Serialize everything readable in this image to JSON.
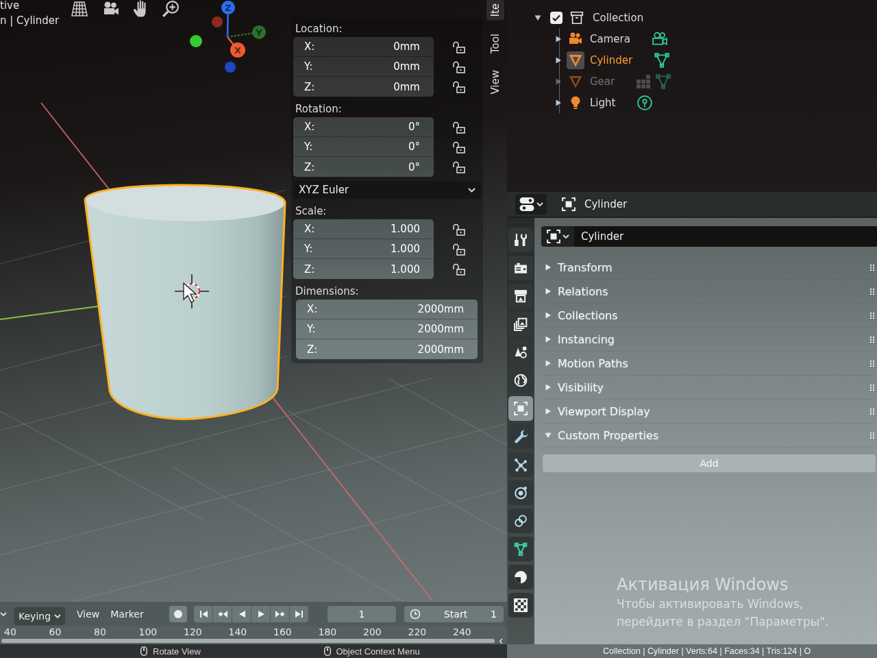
{
  "viewport": {
    "header": {
      "view_name": "tive",
      "object_info": "n | Cylinder"
    },
    "gizmo": [
      {
        "label": "Z",
        "color": "#2a6ff0"
      },
      {
        "label": "X",
        "color": "#ef5a32"
      },
      {
        "label": "Y",
        "color": "#2f6e2c"
      }
    ],
    "sidebar": {
      "tabs": [
        {
          "label": "Ite",
          "selected": true
        },
        {
          "label": "Tool",
          "selected": false
        },
        {
          "label": "View",
          "selected": false
        }
      ],
      "sections": [
        {
          "kind": "vector",
          "label": "Location:",
          "fields": [
            {
              "axis": "X:",
              "value": "0mm",
              "locked": false
            },
            {
              "axis": "Y:",
              "value": "0mm",
              "locked": false
            },
            {
              "axis": "Z:",
              "value": "0mm",
              "locked": false
            }
          ]
        },
        {
          "kind": "vector",
          "label": "Rotation:",
          "fields": [
            {
              "axis": "X:",
              "value": "0°",
              "locked": false
            },
            {
              "axis": "Y:",
              "value": "0°",
              "locked": false
            },
            {
              "axis": "Z:",
              "value": "0°",
              "locked": false
            }
          ]
        },
        {
          "kind": "dropdown",
          "value": "XYZ Euler"
        },
        {
          "kind": "vector",
          "label": "Scale:",
          "fields": [
            {
              "axis": "X:",
              "value": "1.000",
              "locked": false
            },
            {
              "axis": "Y:",
              "value": "1.000",
              "locked": false
            },
            {
              "axis": "Z:",
              "value": "1.000",
              "locked": false
            }
          ]
        },
        {
          "kind": "vector",
          "label": "Dimensions:",
          "fields": [
            {
              "axis": "X:",
              "value": "2000mm"
            },
            {
              "axis": "Y:",
              "value": "2000mm"
            },
            {
              "axis": "Z:",
              "value": "2000mm"
            }
          ]
        }
      ]
    }
  },
  "timeline": {
    "menus": [
      {
        "label": "Keying",
        "kind": "dropdown"
      },
      {
        "label": "View",
        "kind": "menu"
      },
      {
        "label": "Marker",
        "kind": "menu"
      }
    ],
    "current_frame": "1",
    "start": {
      "label": "Start",
      "value": "1"
    },
    "ruler": [
      "40",
      "60",
      "80",
      "100",
      "120",
      "140",
      "160",
      "180",
      "200",
      "220",
      "240"
    ]
  },
  "outliner": {
    "items": [
      {
        "label": "Collection",
        "kind": "collection",
        "expanded": true,
        "checked": true,
        "selected": false,
        "hidden": false,
        "children": [
          {
            "label": "Camera",
            "kind": "camera",
            "expanded": false,
            "selected": false,
            "hidden": false,
            "modifiers": false
          },
          {
            "label": "Cylinder",
            "kind": "mesh",
            "expanded": false,
            "selected": true,
            "hidden": false,
            "modifiers": false
          },
          {
            "label": "Gear",
            "kind": "mesh",
            "expanded": false,
            "selected": false,
            "hidden": true,
            "modifiers": true
          },
          {
            "label": "Light",
            "kind": "light",
            "expanded": false,
            "selected": false,
            "hidden": false,
            "modifiers": false
          }
        ]
      }
    ]
  },
  "properties": {
    "header": {
      "title": "Cylinder"
    },
    "tabs": [
      {
        "kind": "tool",
        "selected": false
      },
      {
        "kind": "render",
        "selected": false
      },
      {
        "kind": "output",
        "selected": false
      },
      {
        "kind": "view_layer",
        "selected": false
      },
      {
        "kind": "scene",
        "selected": false
      },
      {
        "kind": "world",
        "selected": false
      },
      {
        "kind": "object",
        "selected": true
      },
      {
        "kind": "modifiers",
        "selected": false
      },
      {
        "kind": "particles",
        "selected": false
      },
      {
        "kind": "physics",
        "selected": false
      },
      {
        "kind": "constraints",
        "selected": false
      },
      {
        "kind": "data",
        "selected": false
      },
      {
        "kind": "material",
        "selected": false
      },
      {
        "kind": "texture",
        "selected": false
      }
    ],
    "object_name": "Cylinder",
    "panels": [
      {
        "label": "Transform",
        "expanded": false
      },
      {
        "label": "Relations",
        "expanded": false
      },
      {
        "label": "Collections",
        "expanded": false
      },
      {
        "label": "Instancing",
        "expanded": false
      },
      {
        "label": "Motion Paths",
        "expanded": false
      },
      {
        "label": "Visibility",
        "expanded": false
      },
      {
        "label": "Viewport Display",
        "expanded": false
      },
      {
        "label": "Custom Properties",
        "expanded": true,
        "button": "Add"
      }
    ]
  },
  "windows_activation": {
    "title": "Активация Windows",
    "lines": [
      "Чтобы активировать Windows,",
      "перейдите в раздел \"Параметры\"."
    ]
  },
  "status_bar": {
    "hints": [
      "Rotate View",
      "Object Context Menu"
    ],
    "stats": "Collection | Cylinder | Verts:64 | Faces:34 | Tris:124 | O"
  }
}
